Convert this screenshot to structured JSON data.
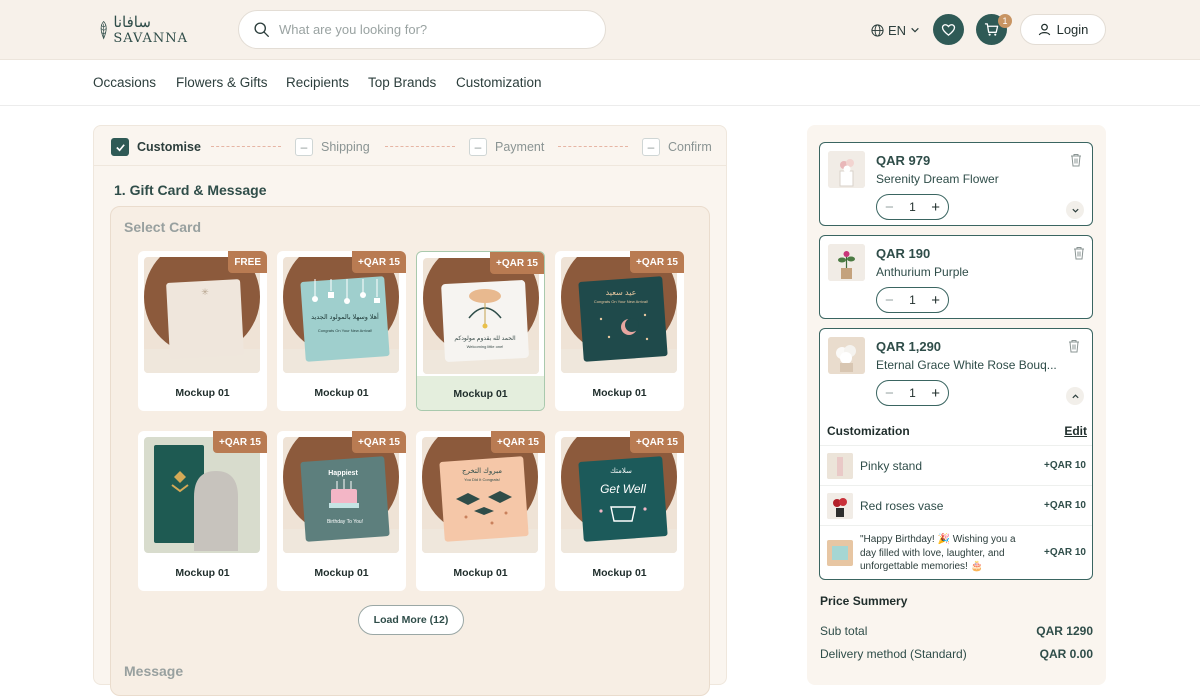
{
  "header": {
    "logo_ar": "سافانا",
    "logo_en": "SAVANNA",
    "search_placeholder": "What are you looking for?",
    "lang": "EN",
    "cart_count": "1",
    "login_label": "Login"
  },
  "nav": [
    "Occasions",
    "Flowers & Gifts",
    "Recipients",
    "Top Brands",
    "Customization"
  ],
  "stepper": {
    "steps": [
      {
        "label": "Customise",
        "state": "done"
      },
      {
        "label": "Shipping",
        "state": "pending"
      },
      {
        "label": "Payment",
        "state": "pending"
      },
      {
        "label": "Confirm",
        "state": "pending"
      }
    ]
  },
  "gift_card": {
    "title": "1. Gift Card & Message",
    "select_label": "Select Card",
    "cards": [
      {
        "label": "Mockup 01",
        "price": "FREE",
        "selected": false
      },
      {
        "label": "Mockup 01",
        "price": "+QAR 15",
        "selected": false
      },
      {
        "label": "Mockup 01",
        "price": "+QAR 15",
        "selected": true
      },
      {
        "label": "Mockup 01",
        "price": "+QAR 15",
        "selected": false
      },
      {
        "label": "Mockup 01",
        "price": "+QAR 15",
        "selected": false
      },
      {
        "label": "Mockup 01",
        "price": "+QAR 15",
        "selected": false
      },
      {
        "label": "Mockup 01",
        "price": "+QAR 15",
        "selected": false
      },
      {
        "label": "Mockup 01",
        "price": "+QAR 15",
        "selected": false
      }
    ],
    "card_texts": {
      "card2_ar": "أهلا وسهلا بالمولود الجديد",
      "card2_en": "Congrats On Your New Arrival!",
      "card3_ar": "الحمد لله بقدوم مولودكم",
      "card3_en": "Welcoming little one!",
      "card4_ar": "عيد سعيد",
      "card4_en": "Congrats On Your New Arrival!",
      "card6_title": "Happiest",
      "card6_sub": "Birthday To You!",
      "card7_ar": "مبروك التخرج",
      "card7_en": "You Did It Congrats!",
      "card8_ar": "سلامتك",
      "card8_en": "Get Well"
    },
    "load_more": "Load More (12)",
    "message_label": "Message"
  },
  "cart": {
    "items": [
      {
        "price": "QAR 979",
        "name": "Serenity Dream Flower",
        "qty": "1"
      },
      {
        "price": "QAR 190",
        "name": "Anthurium Purple",
        "qty": "1"
      },
      {
        "price": "QAR 1,290",
        "name": "Eternal Grace White Rose Bouq...",
        "qty": "1"
      }
    ],
    "customization": {
      "title": "Customization",
      "edit": "Edit",
      "rows": [
        {
          "name": "Pinky stand",
          "price": "+QAR 10"
        },
        {
          "name": "Red roses vase",
          "price": "+QAR 10"
        },
        {
          "name": "\"Happy Birthday! 🎉 Wishing you a day filled with love, laughter, and unforgettable memories! 🎂",
          "price": "+QAR 10"
        }
      ]
    }
  },
  "summary": {
    "title": "Price Summery",
    "rows": [
      {
        "label": "Sub total",
        "value": "QAR 1290"
      },
      {
        "label": "Delivery method (Standard)",
        "value": "QAR 0.00"
      }
    ]
  },
  "colors": {
    "primary": "#2f5a56",
    "accent": "#b97b52",
    "bg_cream": "#faf5ef"
  }
}
